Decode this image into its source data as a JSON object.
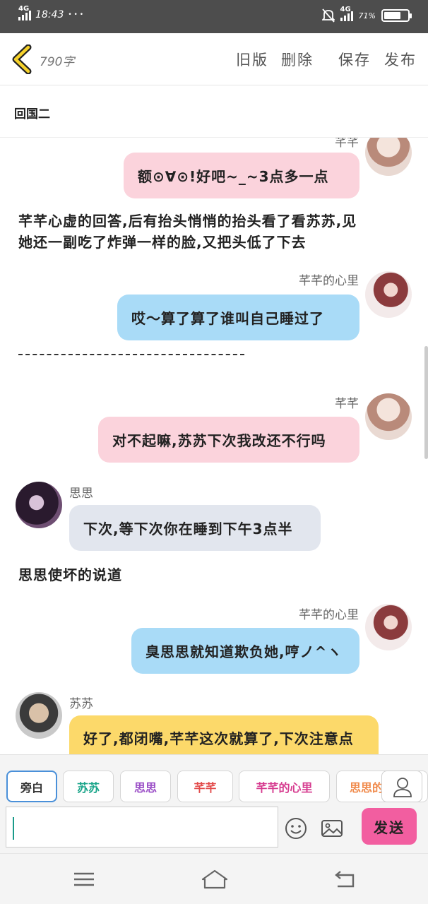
{
  "status_bar": {
    "network_left": "4G",
    "time": "18:43",
    "dots": "• • •",
    "network_right": "4G",
    "battery_text": "71%",
    "battery_level": 0.71
  },
  "header": {
    "word_count": "790字",
    "old_version": "旧版",
    "delete": "删除",
    "save": "保存",
    "publish": "发布"
  },
  "chapter_title": "回国二",
  "messages": {
    "m1_name": "芊芊",
    "m1_text": "额⊙∀⊙!好吧~_~3点多一点",
    "n1_line1": "芊芊心虚的回答,后有抬头悄悄的抬头看了看苏苏,见",
    "n1_line2": "她还一副吃了炸弹一样的脸,又把头低了下去",
    "m2_name": "芊芊的心里",
    "m2_text": "哎～算了算了谁叫自己睡过了",
    "m3_name": "芊芊",
    "m3_text": "对不起嘛,苏苏下次我改还不行吗",
    "m4_name": "思思",
    "m4_text": "下次,等下次你在睡到下午3点半",
    "n2": "思思使坏的说道",
    "m5_name": "芊芊的心里",
    "m5_text": "臭思思就知道欺负她,哼ノ^ヽ",
    "m6_name": "苏苏",
    "m6_text": "好了,都闭嘴,芊芊这次就算了,下次注意点"
  },
  "roles": {
    "narration": "旁白",
    "susu": "苏苏",
    "sisi": "思思",
    "qianqian": "芊芊",
    "qianqian_heart": "芊芊的心里",
    "sisi_heart": "思思的心里"
  },
  "input": {
    "send": "发送",
    "value": ""
  },
  "colors": {
    "pink_bubble": "#fbd3dc",
    "blue_bubble": "#a9dbf7",
    "gray_bubble": "#e2e6ee",
    "yellow_bubble": "#fcd96a",
    "send_button": "#f25ea0",
    "narration_chip": "#333333",
    "susu_chip": "#1aa58a",
    "sisi_chip": "#9b4fc7",
    "qianqian_chip": "#e24a4a",
    "heart_chip": "#d63b8f",
    "sisi_heart_chip": "#f08a4b"
  }
}
